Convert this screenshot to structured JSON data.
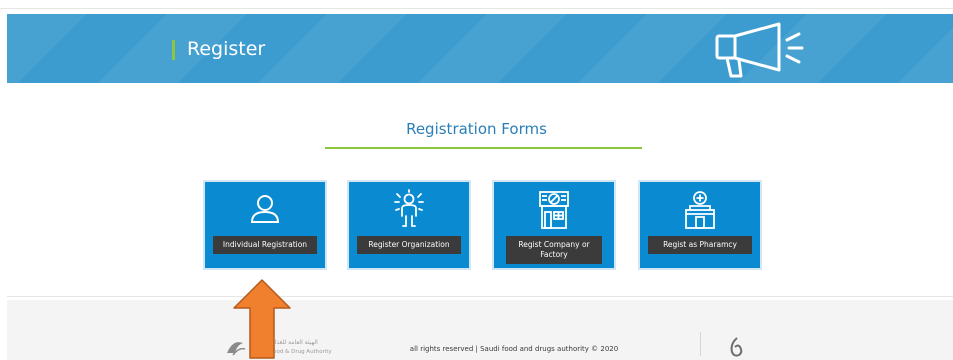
{
  "banner": {
    "title": "Register",
    "icon": "megaphone-icon",
    "accent_color": "#8cc63f",
    "background_color": "#3d9ccf"
  },
  "main": {
    "heading": "Registration Forms",
    "cards": [
      {
        "label": "Individual Registration",
        "icon": "user-icon"
      },
      {
        "label": "Register Organization",
        "icon": "organization-person-icon"
      },
      {
        "label": "Regist Company or Factory",
        "icon": "factory-icon"
      },
      {
        "label": "Regist as Pharamcy",
        "icon": "pharmacy-icon"
      }
    ],
    "card_color": "#0a8ad0"
  },
  "footer": {
    "logo_text_ar": "الهيئة العامة للغذاء والدواء",
    "logo_text_en": "Saudi Food & Drug Authority",
    "copyright": "all rights reserved | Saudi food and drugs authority © 2020"
  },
  "annotation": {
    "icon": "up-arrow-icon",
    "color": "#f07f2e"
  }
}
